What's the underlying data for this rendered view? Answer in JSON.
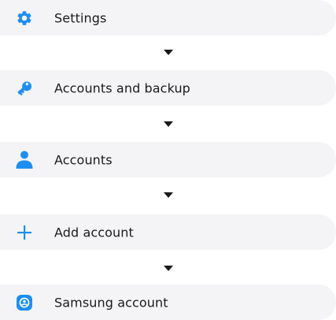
{
  "steps": [
    {
      "label": "Settings",
      "icon": "gear-icon"
    },
    {
      "label": "Accounts and backup",
      "icon": "key-icon"
    },
    {
      "label": "Accounts",
      "icon": "person-icon"
    },
    {
      "label": "Add account",
      "icon": "plus-icon"
    },
    {
      "label": "Samsung account",
      "icon": "samsung-account-icon"
    }
  ],
  "colors": {
    "accent": "#1f8ef1",
    "row_background": "#f4f4f6",
    "text": "#1a1a1a"
  }
}
